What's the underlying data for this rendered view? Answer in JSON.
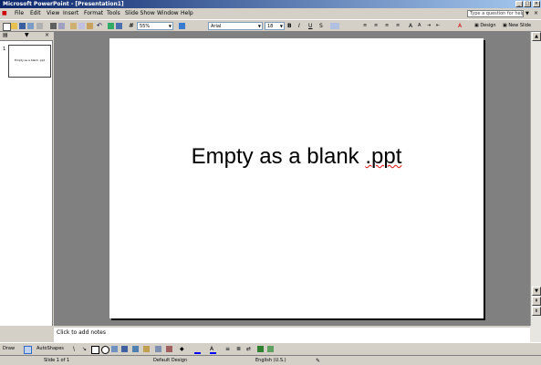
{
  "window": {
    "title": "Microsoft PowerPoint - [Presentation1]"
  },
  "menu": {
    "items": [
      "File",
      "Edit",
      "View",
      "Insert",
      "Format",
      "Tools",
      "Slide Show",
      "Window",
      "Help"
    ],
    "help_placeholder": "Type a question for help"
  },
  "toolbar": {
    "zoom": "55%",
    "font": "Arial",
    "font_size": "18",
    "bold": "B",
    "italic": "I",
    "underline": "U",
    "shadow": "S",
    "design_label": "Design",
    "new_slide_label": "New Slide"
  },
  "left_pane": {
    "slide_number": "1",
    "thumb_text": "Empty as a blank .ppt"
  },
  "slide": {
    "text_main": "Empty as a blank ",
    "text_ppt": ".ppt"
  },
  "notes": {
    "placeholder": "Click to add notes"
  },
  "drawing": {
    "draw_label": "Draw",
    "autoshapes_label": "AutoShapes"
  },
  "status": {
    "slide": "Slide 1 of 1",
    "design": "Default Design",
    "language": "English (U.S.)"
  },
  "colors": {
    "title_start": "#0a246a",
    "title_end": "#a6caf0",
    "workspace": "#808080",
    "chrome": "#d4d0c8"
  }
}
